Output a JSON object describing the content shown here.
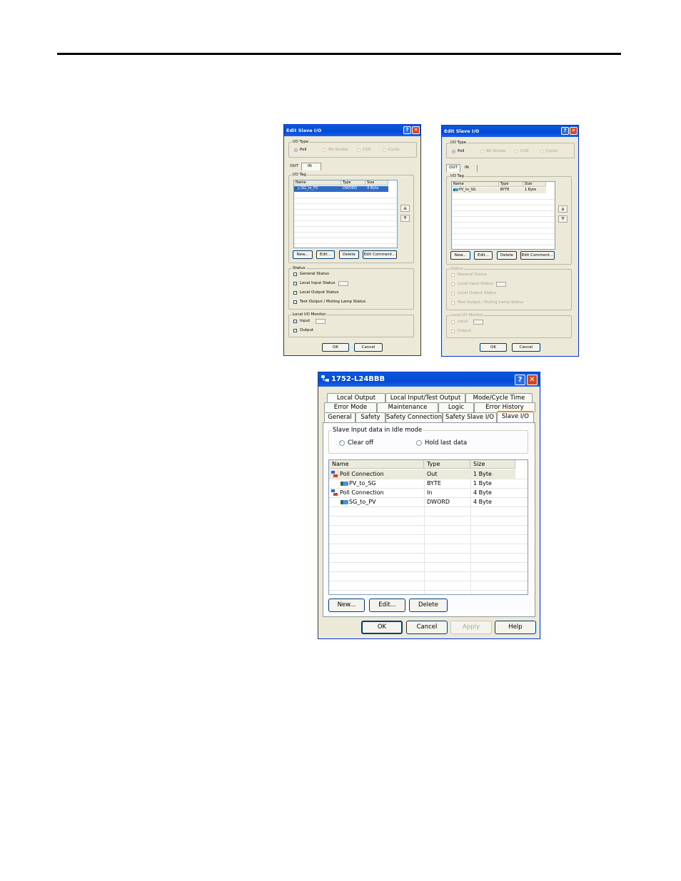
{
  "dialog_out": {
    "title": "Edit Slave I/O",
    "io_type_label": "I/O Type",
    "io_types": [
      "Poll",
      "Bit Strobe",
      "COS",
      "Cyclic"
    ],
    "tabs": [
      "OUT",
      "IN"
    ],
    "active_tab": "IN",
    "io_tag_label": "I/O Tag",
    "columns": [
      "Name",
      "Type",
      "Size"
    ],
    "rows": [
      {
        "name": "SG_to_PV",
        "type": "DWORD",
        "size": "4 Byte"
      }
    ],
    "buttons": {
      "new": "New...",
      "edit": "Edit...",
      "delete": "Delete",
      "edit_comment": "Edit Comment..."
    },
    "status_label": "Status",
    "status_items": [
      "General Status",
      "Local Input Status",
      "Local Output Status",
      "Test Output / Muting Lamp Status"
    ],
    "monitor_label": "Local I/O Monitor",
    "monitor_items": [
      "Input",
      "Output"
    ],
    "ok": "OK",
    "cancel": "Cancel"
  },
  "dialog_in": {
    "title": "Edit Slave I/O",
    "io_type_label": "I/O Type",
    "io_types": [
      "Poll",
      "Bit Strobe",
      "COS",
      "Cyclic"
    ],
    "tabs": [
      "OUT",
      "IN"
    ],
    "active_tab": "OUT",
    "io_tag_label": "I/O Tag",
    "columns": [
      "Name",
      "Type",
      "Size"
    ],
    "rows": [
      {
        "name": "PV_to_SG",
        "type": "BYTE",
        "size": "1 Byte"
      }
    ],
    "buttons": {
      "new": "New...",
      "edit": "Edit...",
      "delete": "Delete",
      "edit_comment": "Edit Comment..."
    },
    "status_label": "Status",
    "status_items": [
      "General Status",
      "Local Input Status",
      "Local Output Status",
      "Test Output / Muting Lamp Status"
    ],
    "monitor_label": "Local I/O Monitor",
    "monitor_items": [
      "Input",
      "Output"
    ],
    "ok": "OK",
    "cancel": "Cancel"
  },
  "main_dialog": {
    "title": "1752-L24BBB",
    "tabs_row1": [
      "Local Output",
      "Local Input/Test Output",
      "Mode/Cycle Time"
    ],
    "tabs_row2": [
      "Error Mode",
      "Maintenance",
      "Logic",
      "Error History"
    ],
    "tabs_row3": [
      "General",
      "Safety",
      "Safety Connection",
      "Safety Slave I/O",
      "Slave I/O"
    ],
    "active_tab": "Slave I/O",
    "idle_group_label": "Slave Input data in Idle mode",
    "idle_options": [
      "Clear off",
      "Hold last data"
    ],
    "idle_selected": "Clear off",
    "columns": [
      "Name",
      "Type",
      "Size"
    ],
    "rows": [
      {
        "name": "Poll Connection",
        "type": "Out",
        "size": "1 Byte",
        "kind": "connection"
      },
      {
        "name": "PV_to_SG",
        "type": "BYTE",
        "size": "1 Byte",
        "kind": "tag"
      },
      {
        "name": "Poll Connection",
        "type": "In",
        "size": "4 Byte",
        "kind": "connection"
      },
      {
        "name": "SG_to_PV",
        "type": "DWORD",
        "size": "4 Byte",
        "kind": "tag"
      }
    ],
    "buttons": {
      "new": "New...",
      "edit": "Edit...",
      "delete": "Delete"
    },
    "footer": {
      "ok": "OK",
      "cancel": "Cancel",
      "apply": "Apply",
      "help": "Help"
    }
  },
  "colors": {
    "titlebar": "#0349d8",
    "dialog_bg": "#ece9d8",
    "selection": "#316ac5",
    "close": "#d9451e"
  }
}
